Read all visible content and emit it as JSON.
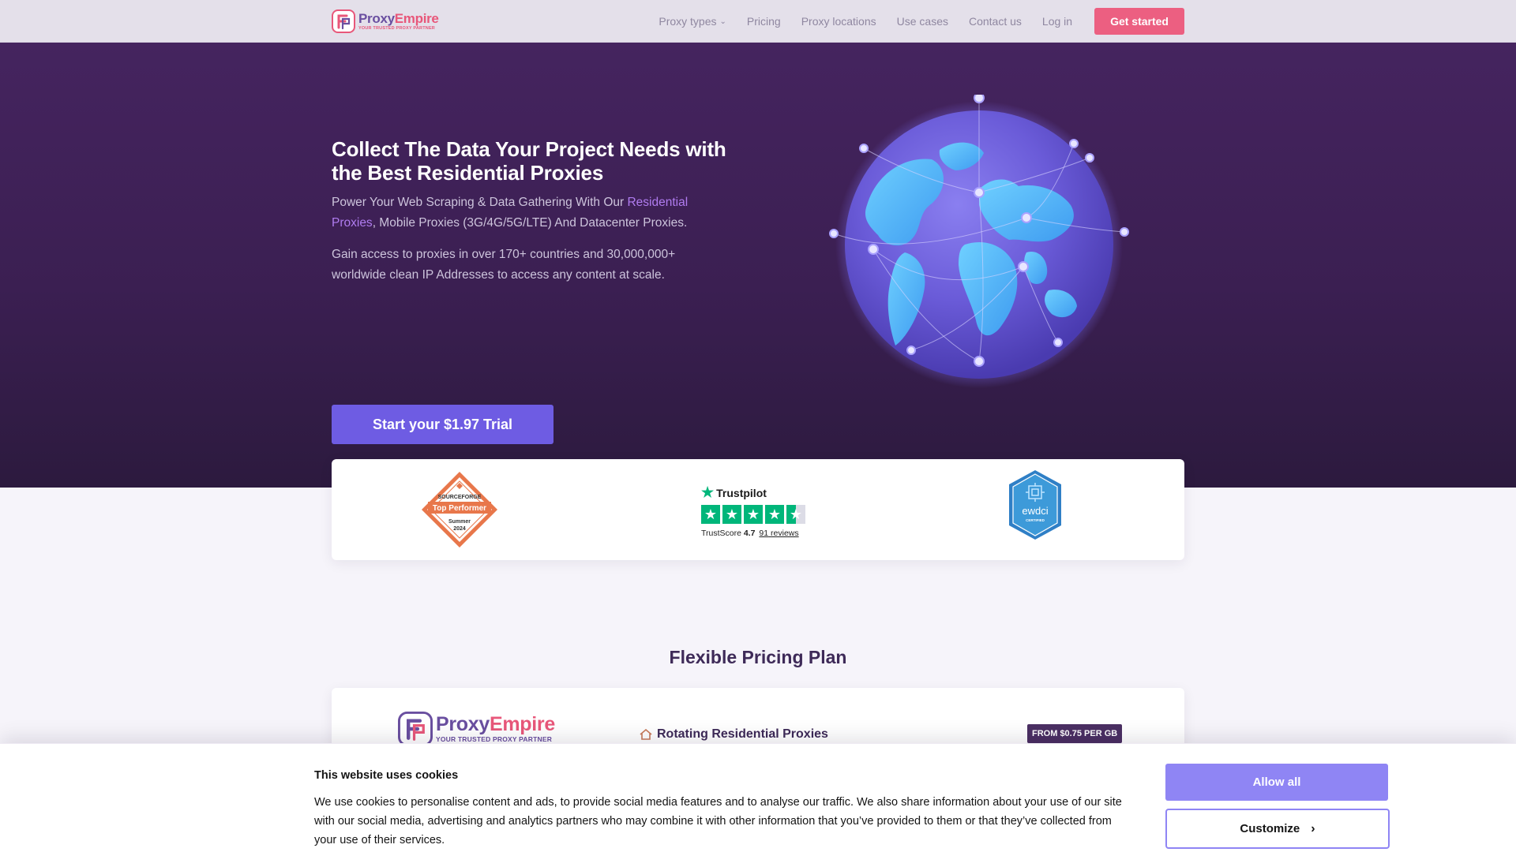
{
  "nav": {
    "logo": {
      "name_part1": "Proxy",
      "name_part2": "Empire",
      "tagline": "YOUR TRUSTED PROXY PARTNER"
    },
    "links": [
      {
        "label": "Proxy types",
        "has_dropdown": true
      },
      {
        "label": "Pricing"
      },
      {
        "label": "Proxy locations"
      },
      {
        "label": "Use cases"
      },
      {
        "label": "Contact us"
      },
      {
        "label": "Log in"
      }
    ],
    "cta": "Get started"
  },
  "hero": {
    "title": "Collect The Data Your Project Needs with the Best Residential Proxies",
    "subtitle_before": "Power Your Web Scraping & Data Gathering With Our ",
    "subtitle_link": "Residential Proxies",
    "subtitle_after": ", Mobile Proxies (3G/4G/5G/LTE) And Datacenter Proxies.",
    "paragraph": "Gain access to proxies in over 170+ countries and 30,000,000+ worldwide clean IP Addresses to access any content at scale.",
    "cta": "Start your $1.97 Trial"
  },
  "badges": {
    "sourceforge": {
      "brand": "SOURCEFORGE",
      "title": "Top Performer",
      "season": "Summer",
      "year": "2024"
    },
    "trustpilot": {
      "brand": "Trustpilot",
      "score_label": "TrustScore",
      "score": "4.7",
      "reviews_count": "91",
      "reviews_label": "reviews",
      "stars": 4.5
    },
    "ewdci": {
      "label": "ewdci",
      "sublabel": "CERTIFIED"
    }
  },
  "pricing": {
    "heading": "Flexible Pricing Plan",
    "card": {
      "logo": {
        "name_part1": "Proxy",
        "name_part2": "Empire",
        "tagline": "YOUR TRUSTED PROXY PARTNER"
      },
      "plan_name": "Rotating Residential Proxies",
      "price_badge": "FROM $0.75 PER GB"
    }
  },
  "cookie": {
    "title": "This website uses cookies",
    "text": "We use cookies to personalise content and ads, to provide social media features and to analyse our traffic. We also share information about your use of our site with our social media, advertising and analytics partners who may combine it with other information that you’ve provided to them or that they’ve collected from your use of their services.",
    "allow_all": "Allow all",
    "customize": "Customize"
  },
  "colors": {
    "brand_pink": "#ec5f81",
    "brand_purple": "#6e5ce3",
    "hero_bg": "#3b1f52",
    "trustpilot_green": "#00b67a",
    "cookie_accent": "#8f85f4"
  }
}
